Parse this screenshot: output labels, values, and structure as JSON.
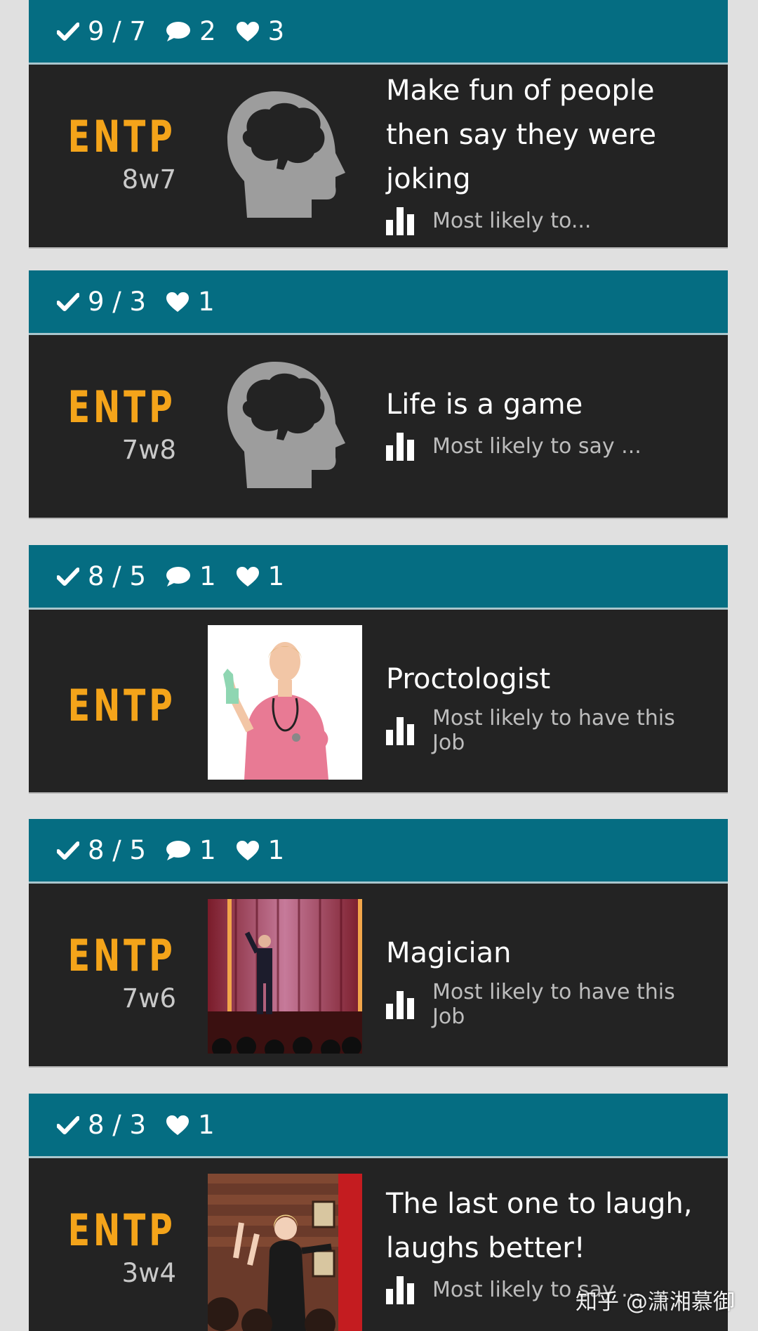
{
  "cards": [
    {
      "stats": {
        "agree": "9 / 7",
        "comments": "2",
        "likes": "3"
      },
      "type": "ENTP",
      "wing": "8w7",
      "image": "brain-head-icon",
      "title": "Make fun of people then say they were joking",
      "subtitle": "Most likely to..."
    },
    {
      "stats": {
        "agree": "9 / 3",
        "likes": "1"
      },
      "type": "ENTP",
      "wing": "7w8",
      "image": "brain-head-icon",
      "title": "Life is a game",
      "subtitle": "Most likely to say ..."
    },
    {
      "stats": {
        "agree": "8 / 5",
        "comments": "1",
        "likes": "1"
      },
      "type": "ENTP",
      "wing": "",
      "image": "nurse-photo",
      "title": "Proctologist",
      "subtitle": "Most likely to have this Job"
    },
    {
      "stats": {
        "agree": "8 / 5",
        "comments": "1",
        "likes": "1"
      },
      "type": "ENTP",
      "wing": "7w6",
      "image": "magician-stage-photo",
      "title": "Magician",
      "subtitle": "Most likely to have this Job"
    },
    {
      "stats": {
        "agree": "8 / 3",
        "likes": "1"
      },
      "type": "ENTP",
      "wing": "3w4",
      "image": "comedy-club-photo",
      "title": "The last one to laugh, laughs better!",
      "subtitle": "Most likely to say ..."
    }
  ],
  "watermark": "知乎 @潇湘慕御",
  "colors": {
    "header": "#056d82",
    "body": "#232323",
    "type": "#f4a41a",
    "background": "#e0e0e0"
  }
}
